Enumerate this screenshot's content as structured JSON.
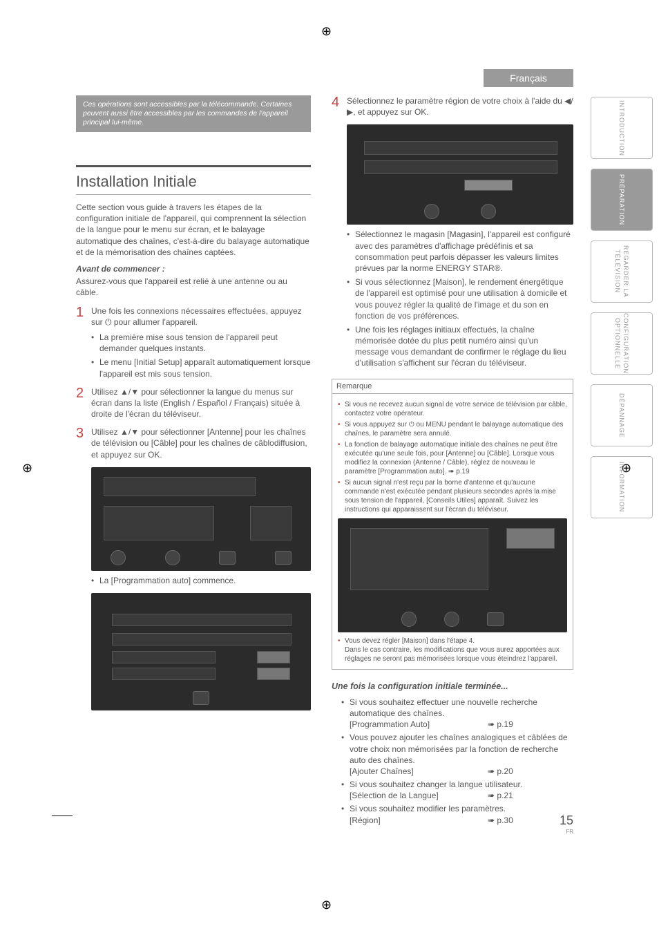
{
  "lang_tab": "Français",
  "intro_box": "Ces opérations sont accessibles par la télécommande. Certaines peuvent aussi être accessibles par les commandes de l'appareil principal lui-même.",
  "section_title": "Installation Initiale",
  "intro_para": "Cette section vous guide à travers les étapes de la configuration initiale de l'appareil, qui comprennent la sélection de la langue pour le menu sur écran, et le balayage automatique des chaînes, c'est-à-dire du balayage automatique et de la mémorisation des chaînes captées.",
  "before_head": "Avant de commencer :",
  "before_text": "Assurez-vous que l'appareil est relié à une antenne ou au câble.",
  "step1": {
    "num": "1",
    "text": "Une fois les connexions nécessaires effectuées, appuyez sur ⏻ pour allumer l'appareil.",
    "bullets": [
      "La première mise sous tension de l'appareil peut demander quelques instants.",
      "Le menu [Initial Setup] apparaît automatiquement lorsque l'appareil est mis sous tension."
    ]
  },
  "step2": {
    "num": "2",
    "text": "Utilisez ▲/▼ pour sélectionner la langue du menus sur écran dans la liste (English / Español / Français) située à droite de l'écran du téléviseur."
  },
  "step3": {
    "num": "3",
    "text": "Utilisez ▲/▼ pour sélectionner [Antenne] pour les chaînes de télévision ou [Câble] pour les chaînes de câblodiffusion, et appuyez sur OK.",
    "after": "La [Programmation auto] commence."
  },
  "step4": {
    "num": "4",
    "text": "Sélectionnez le paramètre région de votre choix à l'aide du ◀/▶, et appuyez sur OK.",
    "bullets": [
      "Sélectionnez le magasin [Magasin], l'appareil est configuré avec des paramètres d'affichage prédéfinis et sa consommation peut parfois dépasser les valeurs limites prévues par la norme ENERGY STAR®.",
      "Si vous sélectionnez [Maison], le rendement énergétique de l'appareil est optimisé pour une utilisation à domicile et vous pouvez régler la qualité de l'image et du son en fonction de vos préférences.",
      "Une fois les réglages initiaux effectués, la chaîne mémorisée dotée du plus petit numéro ainsi qu'un message vous demandant de confirmer le réglage du lieu d'utilisation s'affichent sur l'écran du téléviseur."
    ]
  },
  "remark_head": "Remarque",
  "remarks": [
    "Si vous ne recevez aucun signal de votre service de télévision par câble, contactez votre opérateur.",
    "Si vous appuyez sur ⏻ ou MENU pendant le balayage automatique des chaînes, le paramètre sera annulé.",
    "La fonction de balayage automatique initiale des chaînes ne peut être exécutée qu'une seule fois, pour [Antenne] ou [Câble]. Lorsque vous modifiez la connexion (Antenne / Câble), réglez de nouveau le paramètre [Programmation auto]. ➠ p.19",
    "Si aucun signal n'est reçu par la borne d'antenne et qu'aucune commande n'est exécutée pendant plusieurs secondes après la mise sous tension de l'appareil, [Conseils Utiles] apparaît. Suivez les instructions qui apparaissent sur l'écran du téléviseur."
  ],
  "remark_footer": "Vous devez régler [Maison] dans l'étape 4.\nDans le cas contraire, les modifications que vous aurez apportées aux réglages ne seront pas mémorisées lorsque vous éteindrez l'appareil.",
  "after_head": "Une fois la configuration initiale terminée...",
  "after_items": [
    {
      "text": "Si vous souhaitez effectuer une nouvelle recherche automatique des chaînes.",
      "label": "[Programmation Auto]",
      "page": "➠ p.19"
    },
    {
      "text": "Vous pouvez ajouter les chaînes analogiques et câblées de votre choix non mémorisées par la fonction de recherche auto des chaînes.",
      "label": "[Ajouter Chaînes]",
      "page": "➠ p.20"
    },
    {
      "text": "Si vous souhaitez changer la langue utilisateur.",
      "label": "[Sélection de la Langue]",
      "page": "➠ p.21"
    },
    {
      "text": "Si vous souhaitez modifier les paramètres.",
      "label": "[Région]",
      "page": "➠ p.30"
    }
  ],
  "side_tabs": [
    "INTRODUCTION",
    "PRÉPARATION",
    "REGARDER LA TÉLÉVISION",
    "CONFIGURATION OPTIONNELLE",
    "DÉPANNAGE",
    "INFORMATION"
  ],
  "active_tab_index": 1,
  "page_number": "15",
  "page_lang": "FR"
}
